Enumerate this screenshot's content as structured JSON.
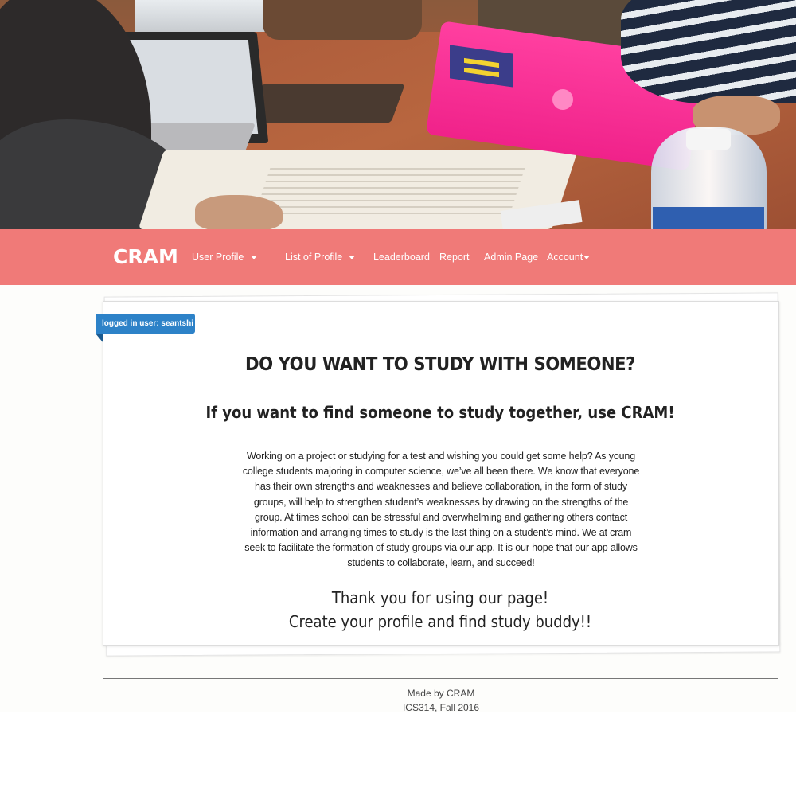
{
  "navbar": {
    "brand": "CRAM",
    "items": [
      {
        "label": "User Profile",
        "dropdown": true
      },
      {
        "label": "List of Profile",
        "dropdown": true
      },
      {
        "label": "Leaderboard",
        "dropdown": false
      },
      {
        "label": "Report",
        "dropdown": false
      },
      {
        "label": "Admin Page",
        "dropdown": false
      },
      {
        "label": "Account",
        "dropdown": true
      }
    ],
    "background_color": "#f07a78"
  },
  "main": {
    "logged_in_badge": "logged in user: seantshi",
    "badge_color": "#2d82c8",
    "headline": "DO YOU WANT TO STUDY WITH SOMEONE?",
    "subheadline": "If you want to find someone to study together, use CRAM!",
    "body": "Working on a project or studying for a test and wishing you could get some help? As young college students majoring in computer science, we’ve all been there. We know that everyone has their own strengths and weaknesses and believe collaboration, in the form of study groups, will help to strengthen student’s weaknesses by drawing on the strengths of the group. At times school can be stressful and overwhelming and gathering others contact information and arranging times to study is the last thing on a student’s mind. We at cram seek to facilitate the formation of study groups via our app. It is our hope that our app allows students to collaborate, learn, and succeed!",
    "thanks_line1": "Thank you for using our page!",
    "thanks_line2": "Create your profile and find study buddy!!"
  },
  "footer": {
    "line1": "Made by CRAM",
    "line2": "ICS314, Fall 2016"
  }
}
